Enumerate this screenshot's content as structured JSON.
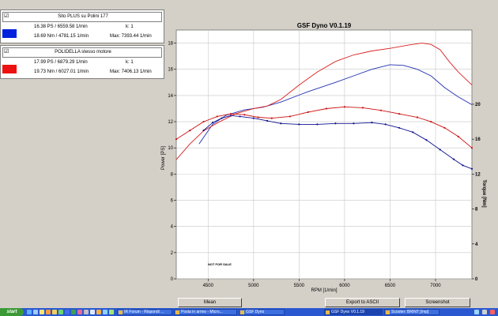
{
  "legend": [
    {
      "checkbox": "☑",
      "title": "Sito PLUS su Polini 177",
      "color": "#0022dd",
      "power": "16.38 PS / 6559.58 1/min",
      "torque": "18.69 Nm / 4781.15 1/min",
      "k": "k: 1",
      "max": "Max: 7393.44 1/min"
    },
    {
      "checkbox": "☑",
      "title": "POLIDELLA stesso motore",
      "color": "#ee1111",
      "power": "17.99 PS / 6879.29 1/min",
      "torque": "19.73 Nm / 6027.01 1/min",
      "k": "k: 1",
      "max": "Max: 7406.13 1/min"
    }
  ],
  "chart_data": {
    "type": "line",
    "title": "GSF Dyno V0.1.19",
    "xlabel": "RPM [1/min]",
    "ylabel": "Power [PS]",
    "y2label": "Torque [Nm]",
    "xlim": [
      4150,
      7400
    ],
    "ylim": [
      0,
      19
    ],
    "y2lim": [
      0,
      28.5
    ],
    "xticks": [
      "4500",
      "5000",
      "5500",
      "6000",
      "6500",
      "7000"
    ],
    "yticks": [
      "0",
      "2",
      "4",
      "6",
      "8",
      "10",
      "12",
      "14",
      "16",
      "18"
    ],
    "y2ticks": [
      "0",
      "4",
      "8",
      "12",
      "16",
      "20"
    ],
    "grid": true,
    "watermark": "NOT FOR SALE",
    "series": [
      {
        "name": "Sito PLUS su Polini 177",
        "kind": "power",
        "axis": "left",
        "color": "#2030b0",
        "x": [
          4400,
          4550,
          4700,
          4900,
          5100,
          5300,
          5600,
          5900,
          6100,
          6300,
          6500,
          6650,
          6800,
          6950,
          7100,
          7250,
          7400
        ],
        "y": [
          10.3,
          11.8,
          12.5,
          12.9,
          13.1,
          13.5,
          14.3,
          15.0,
          15.5,
          16.0,
          16.35,
          16.3,
          16.0,
          15.5,
          14.6,
          13.9,
          13.3
        ]
      },
      {
        "name": "POLIDELLA stesso motore",
        "kind": "power",
        "axis": "left",
        "color": "#d82020",
        "x": [
          4150,
          4300,
          4450,
          4600,
          4800,
          5000,
          5150,
          5300,
          5500,
          5700,
          5900,
          6100,
          6300,
          6500,
          6700,
          6850,
          6950,
          7050,
          7150,
          7250,
          7400
        ],
        "y": [
          9.1,
          10.3,
          11.3,
          11.9,
          12.6,
          13.0,
          13.2,
          13.7,
          14.8,
          15.8,
          16.6,
          17.1,
          17.4,
          17.6,
          17.85,
          18.0,
          17.9,
          17.5,
          16.6,
          15.8,
          14.8
        ]
      },
      {
        "name": "Sito PLUS su Polini 177",
        "kind": "torque",
        "axis": "right",
        "color": "#101090",
        "x": [
          4450,
          4550,
          4650,
          4750,
          4850,
          5000,
          5150,
          5300,
          5500,
          5700,
          5900,
          6100,
          6300,
          6450,
          6600,
          6750,
          6900,
          7050,
          7200,
          7300,
          7400
        ],
        "y": [
          17.0,
          17.9,
          18.4,
          18.7,
          18.6,
          18.4,
          18.1,
          17.8,
          17.7,
          17.7,
          17.8,
          17.8,
          17.9,
          17.7,
          17.3,
          16.8,
          15.9,
          14.8,
          13.7,
          13.0,
          12.6
        ]
      },
      {
        "name": "POLIDELLA stesso motore",
        "kind": "torque",
        "axis": "right",
        "color": "#cc1010",
        "x": [
          4150,
          4300,
          4450,
          4600,
          4750,
          4900,
          5050,
          5200,
          5400,
          5600,
          5800,
          6000,
          6200,
          6400,
          6600,
          6800,
          6950,
          7100,
          7250,
          7400
        ],
        "y": [
          16.0,
          17.0,
          18.0,
          18.6,
          18.9,
          18.8,
          18.5,
          18.4,
          18.6,
          19.1,
          19.5,
          19.7,
          19.6,
          19.3,
          18.9,
          18.5,
          18.0,
          17.3,
          16.3,
          15.0
        ]
      }
    ]
  },
  "buttons": {
    "mean": "Mean",
    "export": "Export to ASCII",
    "screenshot": "Screenshot"
  },
  "taskbar": {
    "start": "start",
    "tasks": [
      "IR Forum - Rispondi ...",
      "Posta in arrivo - Micro...",
      "GSF Dyno",
      "GSF Dyno V0.1.19",
      "Scooter: BRINT [Imp]"
    ]
  }
}
